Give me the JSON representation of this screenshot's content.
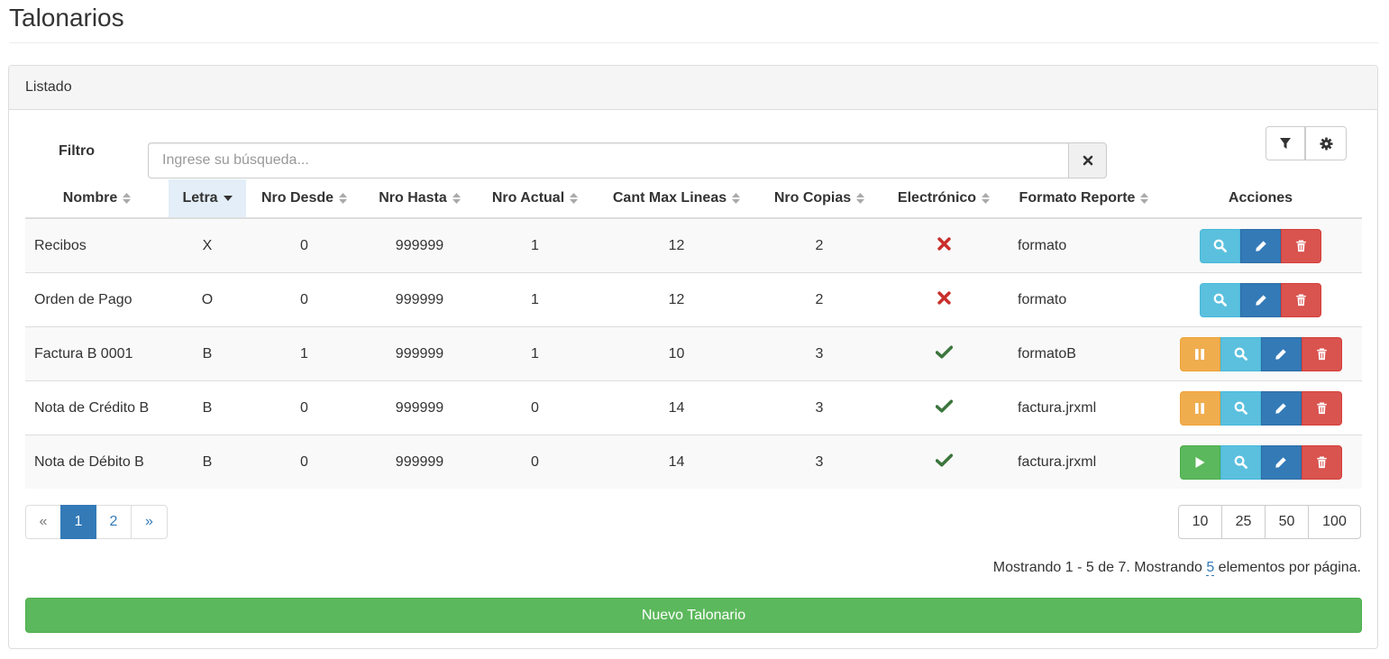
{
  "page": {
    "title": "Talonarios"
  },
  "panel": {
    "heading": "Listado"
  },
  "filter": {
    "label": "Filtro",
    "placeholder": "Ingrese su búsqueda...",
    "value": ""
  },
  "toolbar": {
    "filter_icon": "filter-icon",
    "settings_icon": "gear-icon"
  },
  "table": {
    "columns": [
      {
        "label": "Nombre",
        "sort": "none"
      },
      {
        "label": "Letra",
        "sort": "desc"
      },
      {
        "label": "Nro Desde",
        "sort": "none"
      },
      {
        "label": "Nro Hasta",
        "sort": "none"
      },
      {
        "label": "Nro Actual",
        "sort": "none"
      },
      {
        "label": "Cant Max Lineas",
        "sort": "none"
      },
      {
        "label": "Nro Copias",
        "sort": "none"
      },
      {
        "label": "Electrónico",
        "sort": "none"
      },
      {
        "label": "Formato Reporte",
        "sort": "none"
      },
      {
        "label": "Acciones",
        "sort": "disabled"
      }
    ],
    "rows": [
      {
        "nombre": "Recibos",
        "letra": "X",
        "desde": "0",
        "hasta": "999999",
        "actual": "1",
        "max_lineas": "12",
        "copias": "2",
        "electronico": false,
        "formato": "formato",
        "toggle": null
      },
      {
        "nombre": "Orden de Pago",
        "letra": "O",
        "desde": "0",
        "hasta": "999999",
        "actual": "1",
        "max_lineas": "12",
        "copias": "2",
        "electronico": false,
        "formato": "formato",
        "toggle": null
      },
      {
        "nombre": "Factura B 0001",
        "letra": "B",
        "desde": "1",
        "hasta": "999999",
        "actual": "1",
        "max_lineas": "10",
        "copias": "3",
        "electronico": true,
        "formato": "formatoB",
        "toggle": "pause"
      },
      {
        "nombre": "Nota de Crédito B",
        "letra": "B",
        "desde": "0",
        "hasta": "999999",
        "actual": "0",
        "max_lineas": "14",
        "copias": "3",
        "electronico": true,
        "formato": "factura.jrxml",
        "toggle": "pause"
      },
      {
        "nombre": "Nota de Débito B",
        "letra": "B",
        "desde": "0",
        "hasta": "999999",
        "actual": "0",
        "max_lineas": "14",
        "copias": "3",
        "electronico": true,
        "formato": "factura.jrxml",
        "toggle": "play"
      }
    ]
  },
  "pagination": {
    "prev": "«",
    "pages": [
      "1",
      "2"
    ],
    "active": "1",
    "next": "»"
  },
  "page_sizes": [
    "10",
    "25",
    "50",
    "100"
  ],
  "summary": {
    "prefix": "Mostrando 1 - 5 de 7. Mostrando ",
    "per_page": "5",
    "suffix": " elementos por página."
  },
  "new_button": {
    "label": "Nuevo Talonario"
  },
  "colors": {
    "info": "#5bc0de",
    "primary": "#337ab7",
    "danger": "#d9534f",
    "warning": "#f0ad4e",
    "success": "#5cb85c",
    "check": "#3c763d",
    "cross": "#c9302c"
  }
}
